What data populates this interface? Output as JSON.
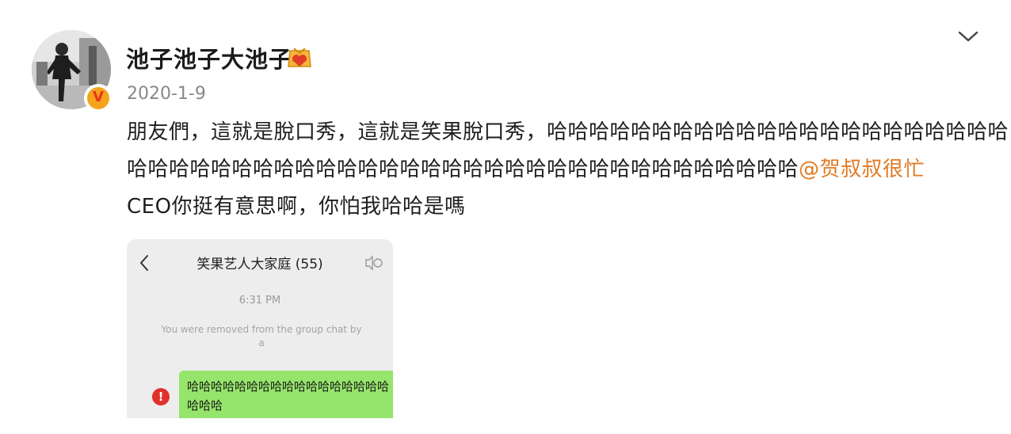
{
  "post": {
    "username": "池子池子大池子",
    "date": "2020-1-9",
    "text_line_1": "朋友們，這就是脫口秀，這就是笑果脫口秀，哈哈哈哈哈哈哈哈哈哈哈哈哈哈哈哈哈哈哈哈哈哈",
    "text_line_2_pre": "哈哈哈哈哈哈哈哈哈哈哈哈哈哈哈哈哈哈哈哈哈哈哈哈哈哈哈哈哈哈哈哈",
    "mention": "@贺叔叔很忙",
    "text_line_3": "CEO你挺有意思啊，你怕我哈哈是嗎"
  },
  "icons": {
    "avatar": "avatar-photo",
    "verified": "verified-v-badge",
    "level": "member-level-badge",
    "more": "chevron-down-icon"
  },
  "colors": {
    "mention": "#e07a24",
    "date": "#888888",
    "verified_bg": "#f3a41b",
    "verified_v": "#e8331c",
    "bubble": "#95e46b",
    "error": "#e0312b"
  },
  "embedded_screenshot": {
    "chat_title": "笑果艺人大家庭 (55)",
    "time": "6:31 PM",
    "notice": "You were removed from the group chat by",
    "notice_suffix": "a",
    "error_mark": "!",
    "message": "哈哈哈哈哈哈哈哈哈哈哈哈哈哈哈哈哈哈哈哈"
  }
}
